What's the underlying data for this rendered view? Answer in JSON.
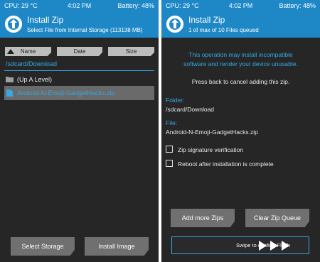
{
  "colors": {
    "accent": "#1e88c7",
    "link": "#33a9e6",
    "background": "#262626",
    "selected_row": "#6a6a6a",
    "button": "#707070"
  },
  "left": {
    "status": {
      "cpu": "CPU: 29 °C",
      "time": "4:02 PM",
      "battery": "Battery: 48%"
    },
    "header": {
      "title": "Install Zip",
      "subtitle": "Select File from Internal Storage (113138 MB)",
      "logo_icon": "twrp-logo-icon"
    },
    "sort": {
      "name": "Name",
      "date": "Date",
      "size": "Size"
    },
    "path": "/sdcard/Download",
    "files": [
      {
        "name": "(Up A Level)",
        "icon": "folder-icon"
      },
      {
        "name": "Android-N-Emoji-GadgetHacks.zip",
        "icon": "file-icon",
        "selected": true
      }
    ],
    "buttons": {
      "select_storage": "Select Storage",
      "install_image": "Install Image"
    }
  },
  "right": {
    "status": {
      "cpu": "CPU: 29 °C",
      "time": "4:02 PM",
      "battery": "Battery: 48%"
    },
    "header": {
      "title": "Install Zip",
      "subtitle": "1 of max of 10 Files queued",
      "logo_icon": "twrp-logo-icon"
    },
    "warning_line1": "This operation may install incompatible",
    "warning_line2": "software and render your device unusable.",
    "back_note": "Press back to cancel adding this zip.",
    "folder_label": "Folder:",
    "folder_value": "/sdcard/Download",
    "file_label": "File:",
    "file_value": "Android-N-Emoji-GadgetHacks.zip",
    "options": [
      {
        "label": "Zip signature verification",
        "checked": false
      },
      {
        "label": "Reboot after installation is complete",
        "checked": false
      }
    ],
    "buttons": {
      "add_more": "Add more Zips",
      "clear_queue": "Clear Zip Queue"
    },
    "swipe_text": "Swipe to confirm Flash"
  }
}
